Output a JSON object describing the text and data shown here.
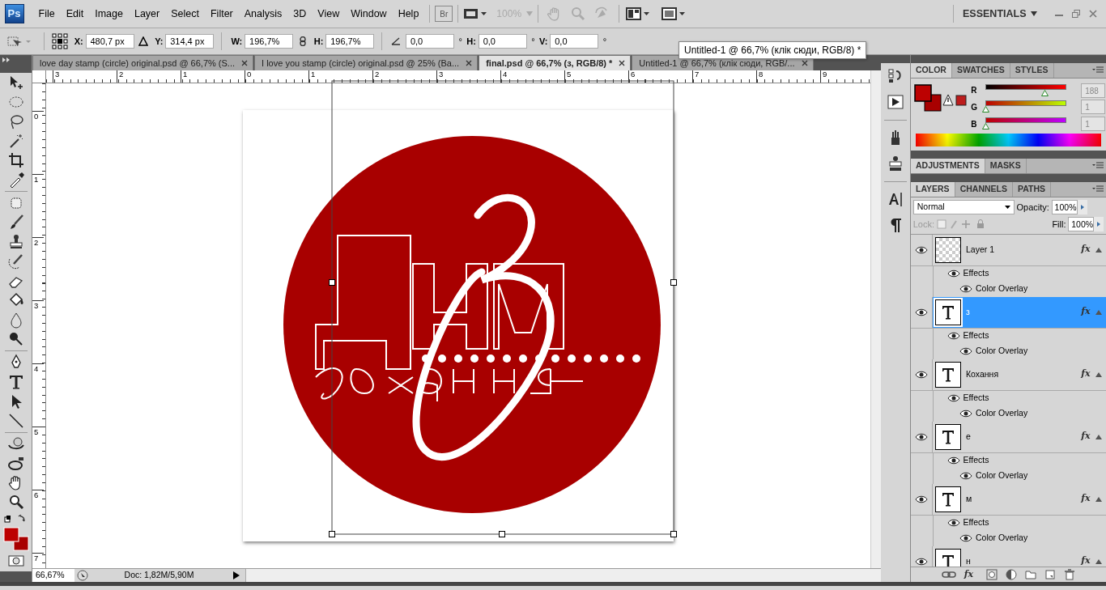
{
  "app_logo": "Ps",
  "menu": [
    "File",
    "Edit",
    "Image",
    "Layer",
    "Select",
    "Filter",
    "Analysis",
    "3D",
    "View",
    "Window",
    "Help"
  ],
  "bridge_button": "Br",
  "zoom_level": {
    "value": "100%",
    "disabled": true
  },
  "workspace": "ESSENTIALS",
  "options": [
    {
      "label": "X:",
      "value": "480,7 px"
    },
    {
      "label": "Y:",
      "value": "314,4 px"
    },
    {
      "label": "W:",
      "value": "196,7%"
    },
    {
      "label": "H:",
      "value": "196,7%"
    },
    {
      "value": "0,0",
      "unit": "°"
    },
    {
      "label": "H:",
      "value": "0,0",
      "unit": "°"
    },
    {
      "label": "V:",
      "value": "0,0",
      "unit": "°"
    }
  ],
  "tooltip": "Untitled-1 @ 66,7% (клік сюди, RGB/8) *",
  "tabs": [
    {
      "label": "love day stamp (circle) original.psd @ 66,7% (S...",
      "selected": false
    },
    {
      "label": "I love you stamp (circle) original.psd @ 25% (Ba...",
      "selected": false
    },
    {
      "label": "final.psd @ 66,7% (з, RGB/8) *",
      "selected": true
    },
    {
      "label": "Untitled-1 @ 66,7% (клік сюди, RGB/...",
      "selected": false
    }
  ],
  "rulers": {
    "horizontal": [
      "3",
      "2",
      "1",
      "0",
      "1",
      "2",
      "3",
      "4",
      "5",
      "6",
      "7",
      "8",
      "9"
    ],
    "vertical": [
      "0",
      "1",
      "2",
      "3",
      "4",
      "5",
      "6",
      "7"
    ]
  },
  "status": {
    "zoom": "66,67%",
    "doc": "Doc: 1,82M/5,90M"
  },
  "color_panel": {
    "tabs": [
      {
        "label": "COLOR",
        "selected": true
      },
      {
        "label": "SWATCHES",
        "selected": false
      },
      {
        "label": "STYLES",
        "selected": false
      }
    ],
    "channels": [
      {
        "name": "R",
        "level": 0.737,
        "reading": "188"
      },
      {
        "name": "G",
        "level": 0.004,
        "reading": "1"
      },
      {
        "name": "B",
        "level": 0.004,
        "reading": "1"
      }
    ]
  },
  "adjustments_tabs": [
    {
      "label": "ADJUSTMENTS",
      "selected": true
    },
    {
      "label": "MASKS",
      "selected": false
    }
  ],
  "layers_panel": {
    "tabs": [
      {
        "label": "LAYERS",
        "selected": true
      },
      {
        "label": "CHANNELS",
        "selected": false
      },
      {
        "label": "PATHS",
        "selected": false
      }
    ],
    "blend_mode": "Normal",
    "opacity_label": "Opacity:",
    "opacity": "100%",
    "lock_label": "Lock:",
    "fill_label": "Fill:",
    "fill": "100%",
    "effects_button": "fx",
    "layers": [
      {
        "name": "Layer 1",
        "kind": "pixel",
        "selected": false,
        "visible": true,
        "fx": "fx",
        "effects_label": "Effects",
        "effects": [
          "Color Overlay"
        ]
      },
      {
        "name": "з",
        "kind": "type",
        "selected": true,
        "visible": true,
        "fx": "fx",
        "effects_label": "Effects",
        "effects": [
          "Color Overlay"
        ]
      },
      {
        "name": "Кохання",
        "kind": "type",
        "selected": false,
        "visible": true,
        "fx": "fx",
        "effects_label": "Effects",
        "effects": [
          "Color Overlay"
        ]
      },
      {
        "name": "е",
        "kind": "type",
        "selected": false,
        "visible": true,
        "fx": "fx",
        "effects_label": "Effects",
        "effects": [
          "Color Overlay"
        ]
      },
      {
        "name": "м",
        "kind": "type",
        "selected": false,
        "visible": true,
        "fx": "fx",
        "effects_label": "Effects",
        "effects": [
          "Color Overlay"
        ]
      },
      {
        "name": "н",
        "kind": "type",
        "selected": false,
        "visible": true,
        "fx": "fx"
      }
    ]
  }
}
